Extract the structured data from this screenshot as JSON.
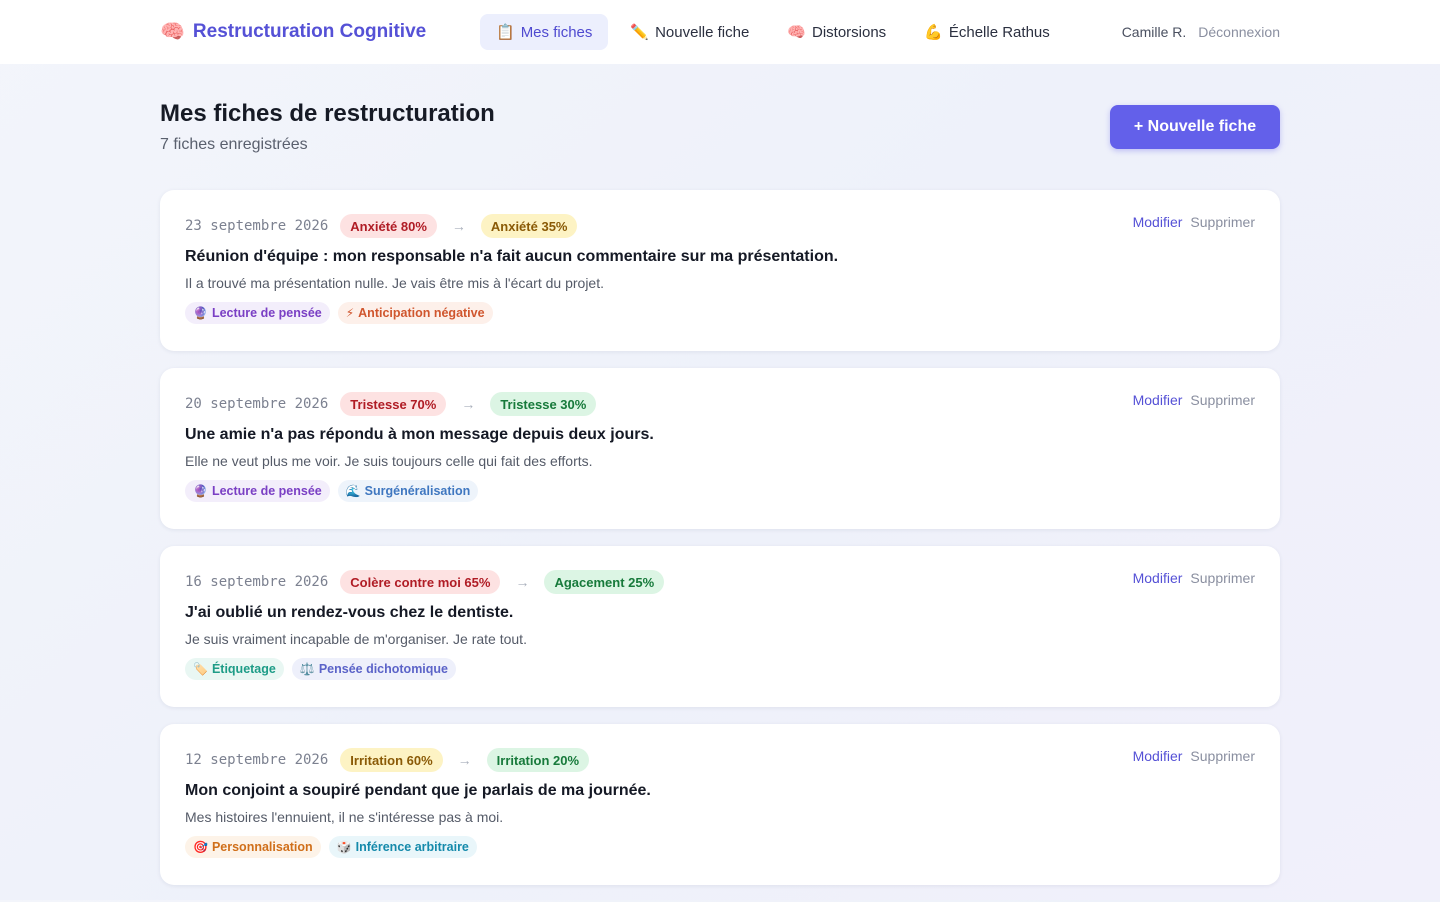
{
  "brand": {
    "icon": "🧠",
    "title": "Restructuration Cognitive"
  },
  "nav": [
    {
      "icon": "📋",
      "label": "Mes fiches",
      "active": true
    },
    {
      "icon": "✏️",
      "label": "Nouvelle fiche",
      "active": false
    },
    {
      "icon": "🧠",
      "label": "Distorsions",
      "active": false
    },
    {
      "icon": "💪",
      "label": "Échelle Rathus",
      "active": false
    }
  ],
  "user": {
    "name": "Camille R.",
    "logout": "Déconnexion"
  },
  "header": {
    "title": "Mes fiches de restructuration",
    "subtitle": "7 fiches enregistrées",
    "new_button": "+ Nouvelle fiche"
  },
  "actions": {
    "edit": "Modifier",
    "delete": "Supprimer"
  },
  "arrow": "→",
  "cards": [
    {
      "date": "23 septembre 2026",
      "before": "Anxiété 80%",
      "before_color": "red",
      "after": "Anxiété 35%",
      "after_color": "yellow",
      "situation": "Réunion d'équipe : mon responsable n'a fait aucun commentaire sur ma présentation.",
      "thought": "Il a trouvé ma présentation nulle. Je vais être mis à l'écart du projet.",
      "tags": [
        {
          "icon": "🔮",
          "label": "Lecture de pensée",
          "color": "purple"
        },
        {
          "icon": "⚡",
          "label": "Anticipation négative",
          "color": "orange"
        }
      ]
    },
    {
      "date": "20 septembre 2026",
      "before": "Tristesse 70%",
      "before_color": "red",
      "after": "Tristesse 30%",
      "after_color": "green",
      "situation": "Une amie n'a pas répondu à mon message depuis deux jours.",
      "thought": "Elle ne veut plus me voir. Je suis toujours celle qui fait des efforts.",
      "tags": [
        {
          "icon": "🔮",
          "label": "Lecture de pensée",
          "color": "purple"
        },
        {
          "icon": "🌊",
          "label": "Surgénéralisation",
          "color": "blue"
        }
      ]
    },
    {
      "date": "16 septembre 2026",
      "before": "Colère contre moi 65%",
      "before_color": "red",
      "after": "Agacement 25%",
      "after_color": "green",
      "situation": "J'ai oublié un rendez-vous chez le dentiste.",
      "thought": "Je suis vraiment incapable de m'organiser. Je rate tout.",
      "tags": [
        {
          "icon": "🏷️",
          "label": "Étiquetage",
          "color": "teal"
        },
        {
          "icon": "⚖️",
          "label": "Pensée dichotomique",
          "color": "indigo"
        }
      ]
    },
    {
      "date": "12 septembre 2026",
      "before": "Irritation 60%",
      "before_color": "yellow",
      "after": "Irritation 20%",
      "after_color": "green",
      "situation": "Mon conjoint a soupiré pendant que je parlais de ma journée.",
      "thought": "Mes histoires l'ennuient, il ne s'intéresse pas à moi.",
      "tags": [
        {
          "icon": "🎯",
          "label": "Personnalisation",
          "color": "amber"
        },
        {
          "icon": "🎲",
          "label": "Inférence arbitraire",
          "color": "cyan"
        }
      ]
    }
  ]
}
